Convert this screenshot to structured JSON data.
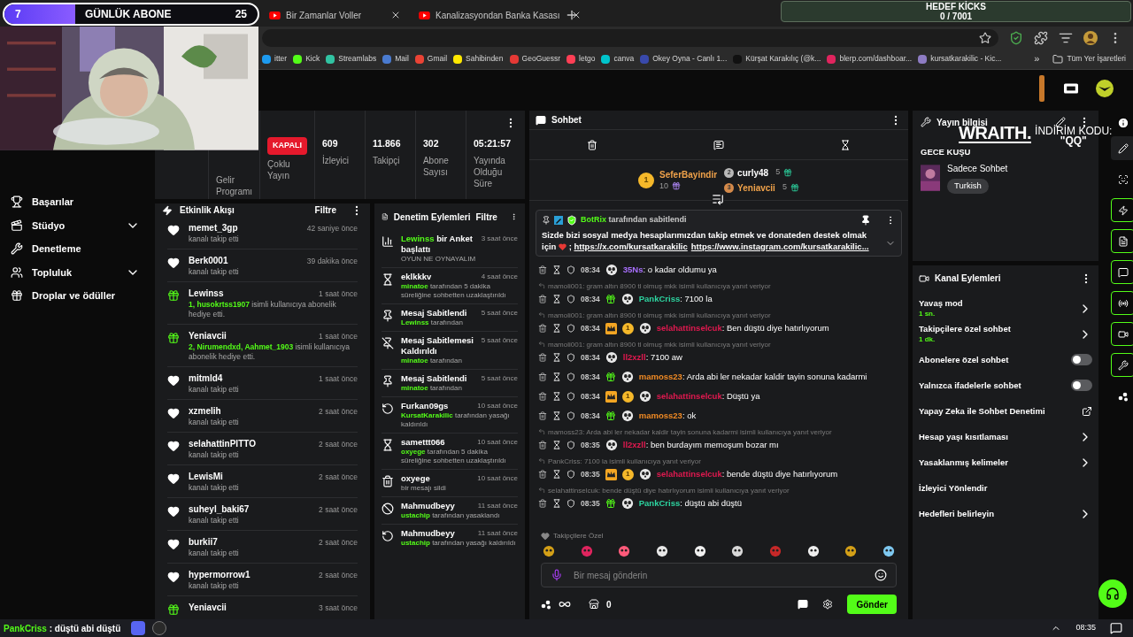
{
  "overlay": {
    "sub_goal": {
      "current": "7",
      "label": "GÜNLÜK ABONE",
      "target": "25",
      "level": 0.28
    },
    "kicks_goal": {
      "title": "HEDEF KİCKS",
      "value": "0 / 7001"
    },
    "sponsor": {
      "logo": "WRAITH.",
      "code_label": "İNDİRİM KODU:",
      "code": "\"QQ\""
    }
  },
  "browser": {
    "tabs": [
      {
        "title": "Bir Zamanlar Voller",
        "selected": false
      },
      {
        "title": "Kanalizasyondan Banka Kasası",
        "selected": false
      }
    ],
    "bookmarks": [
      {
        "label": "itter",
        "color": "#1d9bf0"
      },
      {
        "label": "Kick",
        "color": "#53fc18"
      },
      {
        "label": "Streamlabs",
        "color": "#31c3a2"
      },
      {
        "label": "Mail",
        "color": "#4a7bd0"
      },
      {
        "label": "Gmail",
        "color": "#ea4335"
      },
      {
        "label": "Sahibinden",
        "color": "#ffe800"
      },
      {
        "label": "GeoGuessr",
        "color": "#e53935"
      },
      {
        "label": "letgo",
        "color": "#ff3f55"
      },
      {
        "label": "canva",
        "color": "#00c4cc"
      },
      {
        "label": "Okey Oyna - Canlı 1...",
        "color": "#3949ab"
      },
      {
        "label": "Kürşat Karakılıç (@k...",
        "color": "#111111"
      },
      {
        "label": "blerp.com/dashboar...",
        "color": "#e0245e"
      },
      {
        "label": "kursatkarakilic - Kic...",
        "color": "#8e7cc3"
      }
    ],
    "more": "»",
    "all_bookmarks": "Tüm Yer İşaretleri"
  },
  "sidebar": [
    {
      "label": "Başarılar",
      "submenu": false
    },
    {
      "label": "Stüdyo",
      "submenu": true
    },
    {
      "label": "Denetleme",
      "submenu": false
    },
    {
      "label": "Topluluk",
      "submenu": true
    },
    {
      "label": "Droplar ve ödüller",
      "submenu": false
    }
  ],
  "stats": [
    {
      "kind": "text",
      "label": "Gelir Programı"
    },
    {
      "kind": "badge",
      "badge": "KAPALI",
      "label": "Çoklu Yayın"
    },
    {
      "kind": "stat",
      "value": "609",
      "label": "İzleyici"
    },
    {
      "kind": "stat",
      "value": "11.866",
      "label": "Takipçi"
    },
    {
      "kind": "stat",
      "value": "302",
      "label": "Abone Sayısı"
    },
    {
      "kind": "stat",
      "value": "05:21:57",
      "label": "Yayında Olduğu Süre"
    }
  ],
  "event_feed": {
    "title": "Etkinlik Akışı",
    "filter": "Filtre",
    "items": [
      {
        "kind": "follow",
        "user": "memet_3gp",
        "time": "42 saniye önce",
        "text": "kanalı takip etti"
      },
      {
        "kind": "follow",
        "user": "Berk0001",
        "time": "39 dakika önce",
        "text": "kanalı takip etti"
      },
      {
        "kind": "gift",
        "user": "Lewinss",
        "time": "1 saat önce",
        "highlight": "1, husokrtss1907",
        "text": " isimli kullanıcıya abonelik hediye etti."
      },
      {
        "kind": "gift",
        "user": "Yeniavcii",
        "time": "1 saat önce",
        "highlight": "2, Nirumendxd, Aahmet_1903",
        "text": " isimli kullanıcıya abonelik hediye etti."
      },
      {
        "kind": "follow",
        "user": "mitmld4",
        "time": "1 saat önce",
        "text": "kanalı takip etti"
      },
      {
        "kind": "follow",
        "user": "xzmelih",
        "time": "2 saat önce",
        "text": "kanalı takip etti"
      },
      {
        "kind": "follow",
        "user": "selahattinPITTO",
        "time": "2 saat önce",
        "text": "kanalı takip etti"
      },
      {
        "kind": "follow",
        "user": "LewisMi",
        "time": "2 saat önce",
        "text": "kanalı takip etti"
      },
      {
        "kind": "follow",
        "user": "suheyl_baki67",
        "time": "2 saat önce",
        "text": "kanalı takip etti"
      },
      {
        "kind": "follow",
        "user": "burkii7",
        "time": "2 saat önce",
        "text": "kanalı takip etti"
      },
      {
        "kind": "follow",
        "user": "hypermorrow1",
        "time": "2 saat önce",
        "text": "kanalı takip etti"
      },
      {
        "kind": "gift",
        "user": "Yeniavcii",
        "time": "3 saat önce"
      }
    ]
  },
  "moderation": {
    "title": "Denetim Eylemleri",
    "filter": "Filtre",
    "items": [
      {
        "kind": "poll",
        "title_user": "Lewinss",
        "title": " bir Anket başlattı",
        "time": "3 saat önce",
        "text": "OYUN NE OYNAYALIM"
      },
      {
        "kind": "timeout",
        "title": "eklkkkv",
        "time": "4 saat önce",
        "actor": "minatoe",
        "text": " tarafından 5 dakika süreliğine sohbetten uzaklaştırıldı"
      },
      {
        "kind": "pin",
        "title": "Mesaj Sabitlendi",
        "time": "5 saat önce",
        "actor": "Lewinss",
        "text": " tarafından"
      },
      {
        "kind": "unpin",
        "title": "Mesaj Sabitlemesi Kaldırıldı",
        "time": "5 saat önce",
        "actor": "minatoe",
        "text": " tarafından"
      },
      {
        "kind": "pin",
        "title": "Mesaj Sabitlendi",
        "time": "5 saat önce",
        "actor": "minatoe",
        "text": " tarafından"
      },
      {
        "kind": "unban",
        "title": "Furkan09gs",
        "time": "10 saat önce",
        "actor": "KursatKarakilic",
        "text": " tarafından yasağı kaldırıldı"
      },
      {
        "kind": "timeout",
        "title": "samettt066",
        "time": "10 saat önce",
        "actor": "oxyege",
        "text": " tarafından 5 dakika süreliğine sohbetten uzaklaştırıldı"
      },
      {
        "kind": "delete",
        "title": "oxyege",
        "time": "10 saat önce",
        "text": "bir mesajı sildi"
      },
      {
        "kind": "ban",
        "title": "Mahmudbeyy",
        "time": "11 saat önce",
        "actor": "ustachip",
        "text": " tarafından yasaklandı"
      },
      {
        "kind": "unban",
        "title": "Mahmudbeyy",
        "time": "11 saat önce",
        "actor": "ustachip",
        "text": " tarafından yasağı kaldırıldı"
      }
    ]
  },
  "chat": {
    "title": "Sohbet",
    "leaderboard": [
      {
        "rank": "1",
        "user": "SeferBayindir",
        "count": "10"
      },
      {
        "rank": "2",
        "user": "curly48",
        "count": "5"
      },
      {
        "rank": "3",
        "user": "Yeniavcii",
        "count": "5"
      }
    ],
    "pinned": {
      "by": "BotRix",
      "by_text": " tarafından sabitlendi",
      "text": "Sizde bizi sosyal medya hesaplarımızdan takip etmek ve donateden destek olmak için",
      "sep": " ; ",
      "links": [
        "https://x.com/kursatkarakilic",
        "https://www.instagram.com/kursatkarakilic..."
      ]
    },
    "messages": [
      {
        "time": "08:34",
        "user": "35Ns",
        "color": "#a970ff",
        "text": ": o kadar oldumu ya"
      },
      {
        "reply": "mamoli001: gram altın 8900 tl olmuş mkk isimli kullanıcıya yanıt veriyor",
        "time": "08:34",
        "user": "PankCriss",
        "color": "#2dd4a0",
        "badges": [
          {
            "kind": "sub"
          }
        ],
        "text": ": 7100 la"
      },
      {
        "reply": "mamoli001: gram altın 8900 tl olmuş mkk isimli kullanıcıya yanıt veriyor",
        "time": "08:34",
        "user": "selahattinselcuk",
        "color": "#e0194f",
        "badges": [
          {
            "kind": "crown"
          },
          {
            "kind": "coin",
            "label": "1"
          }
        ],
        "text": ": Ben düştü diye hatırlıyorum"
      },
      {
        "reply": "mamoli001: gram altın 8900 tl olmuş mkk isimli kullanıcıya yanıt veriyor",
        "time": "08:34",
        "user": "ll2xzll",
        "color": "#e0194f",
        "text": ": 7100 aw"
      },
      {
        "time": "08:34",
        "user": "mamoss23",
        "color": "#f08a24",
        "badges": [
          {
            "kind": "sub"
          }
        ],
        "text": ": Arda abi ler nekadar kaldir tayin sonuna kadarmi"
      },
      {
        "time": "08:34",
        "user": "selahattinselcuk",
        "color": "#e0194f",
        "badges": [
          {
            "kind": "crown"
          },
          {
            "kind": "coin",
            "label": "1"
          }
        ],
        "text": ": Düştü ya"
      },
      {
        "time": "08:34",
        "user": "mamoss23",
        "color": "#f08a24",
        "badges": [
          {
            "kind": "sub"
          }
        ],
        "text": ": ok"
      },
      {
        "reply": "mamoss23: Arda abi ler nekadar kaldir tayin sonuna kadarmi isimli kullanıcıya yanıt veriyor",
        "time": "08:35",
        "user": "ll2xzll",
        "color": "#e0194f",
        "text": ": ben burdayım memoşum bozar mı"
      },
      {
        "reply": "PankCriss: 7100 la isimli kullanıcıya yanıt veriyor",
        "time": "08:35",
        "user": "selahattinselcuk",
        "color": "#e0194f",
        "badges": [
          {
            "kind": "crown"
          },
          {
            "kind": "coin",
            "label": "1"
          }
        ],
        "text": ": bende düştü diye hatırlıyorum"
      },
      {
        "reply": "selahattinselcuk: bende düştü diye hatırlıyorum isimli kullanıcıya yanıt veriyor",
        "time": "08:35",
        "user": "PankCriss",
        "color": "#2dd4a0",
        "badges": [
          {
            "kind": "sub"
          }
        ],
        "text": ": düştü abi düştü"
      }
    ],
    "emote_label": "Takipçilere Özel",
    "emotes": [
      {
        "color": "#d4a017"
      },
      {
        "color": "#e0245e"
      },
      {
        "color": "#ff5a7a"
      },
      {
        "color": "#e8e8e8"
      },
      {
        "color": "#f0f0f0"
      },
      {
        "color": "#d8d8d8"
      },
      {
        "color": "#c62828"
      },
      {
        "color": "#eeeeee"
      },
      {
        "color": "#d4a017"
      },
      {
        "color": "#7ec8f0"
      }
    ],
    "placeholder": "Bir mesaj gönderin",
    "points": "0",
    "send": "Gönder"
  },
  "stream_info": {
    "title": "Yayın bilgisi",
    "stream_title": "GECE KUŞU",
    "category": "Sadece Sohbet",
    "tag": "Turkish"
  },
  "channel_actions": {
    "title": "Kanal Eylemleri",
    "items": [
      {
        "kind": "submenu",
        "label": "Yavaş mod",
        "sub": "1 sn."
      },
      {
        "kind": "submenu",
        "label": "Takipçilere özel sohbet",
        "sub": "1 dk."
      },
      {
        "kind": "toggle",
        "label": "Abonelere özel sohbet",
        "on": false
      },
      {
        "kind": "toggle",
        "label": "Yalnızca ifadelerle sohbet",
        "on": false
      },
      {
        "kind": "external",
        "label": "Yapay Zeka ile Sohbet Denetimi"
      },
      {
        "kind": "submenu",
        "label": "Hesap yaşı kısıtlaması"
      },
      {
        "kind": "submenu",
        "label": "Yasaklanmış kelimeler"
      },
      {
        "kind": "plain",
        "label": "İzleyici Yönlendir"
      },
      {
        "kind": "submenu",
        "label": "Hedefleri belirleyin"
      }
    ]
  },
  "rail": [
    {
      "highlighted": false
    },
    {
      "highlighted": false
    },
    {
      "highlighted": true
    },
    {
      "highlighted": true
    },
    {
      "highlighted": true
    },
    {
      "highlighted": true
    },
    {
      "highlighted": true
    },
    {
      "highlighted": true
    },
    {
      "highlighted": false
    }
  ],
  "taskbar": {
    "ticker_user": "PankCriss",
    "ticker_text": " : düştü abi düştü",
    "time": "08:35"
  }
}
